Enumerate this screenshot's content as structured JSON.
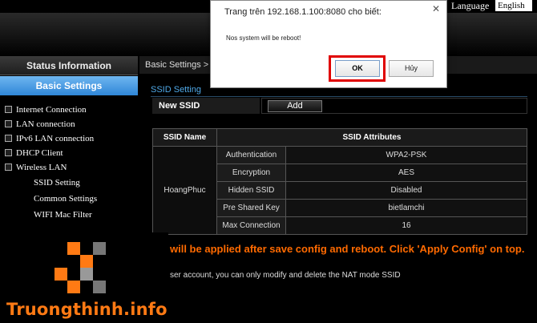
{
  "header": {
    "language_label": "Language",
    "language_value": "English"
  },
  "sidebar": {
    "status_label": "Status Information",
    "basic_label": "Basic Settings",
    "items": [
      {
        "label": "Internet Connection"
      },
      {
        "label": "LAN connection"
      },
      {
        "label": "IPv6 LAN connection"
      },
      {
        "label": "DHCP Client"
      },
      {
        "label": "Wireless LAN"
      }
    ],
    "subitems": [
      {
        "label": "SSID Setting"
      },
      {
        "label": "Common Settings"
      },
      {
        "label": "WIFI Mac Filter"
      }
    ]
  },
  "main": {
    "breadcrumb": "Basic Settings > SS",
    "section_title": "SSID Setting",
    "new_ssid_label": "New SSID",
    "add_label": "Add",
    "table": {
      "headers": [
        "SSID Name",
        "SSID Attributes"
      ],
      "ssid_name": "HoangPhuc",
      "rows": [
        {
          "key": "Authentication",
          "value": "WPA2-PSK"
        },
        {
          "key": "Encryption",
          "value": "AES"
        },
        {
          "key": "Hidden SSID",
          "value": "Disabled"
        },
        {
          "key": "Pre Shared Key",
          "value": "bietlamchi"
        },
        {
          "key": "Max Connection",
          "value": "16"
        }
      ]
    },
    "notice_orange": "will be applied after save config and reboot. Click 'Apply Config' on top.",
    "notice_white": "ser account, you can only modify and delete the NAT mode SSID"
  },
  "dialog": {
    "title": "Trang trên 192.168.1.100:8080 cho biết:",
    "close_icon": "close-icon",
    "message": "Nos system will be reboot!",
    "ok_label": "OK",
    "cancel_label": "Hủy",
    "highlight_color": "#e00000"
  },
  "watermark": {
    "text_part1": "Truongthinh",
    "text_part2": ".info",
    "brand_color": "#ff7a14"
  }
}
